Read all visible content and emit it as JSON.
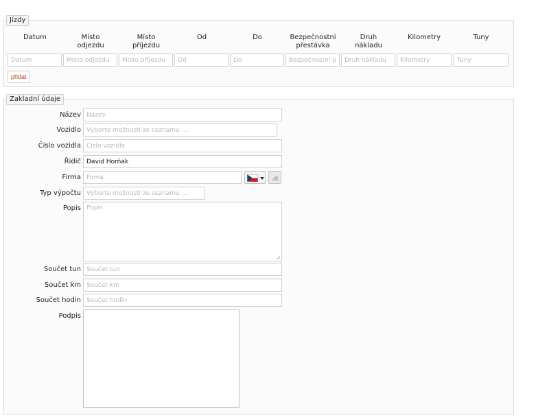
{
  "trips": {
    "legend": "Jízdy",
    "columns": [
      {
        "header": "Datum",
        "placeholder": "Datum"
      },
      {
        "header": "Místo\nodjezdu",
        "placeholder": "Místo odjezdu"
      },
      {
        "header": "Místo\npříjezdu",
        "placeholder": "Místo příjezdu"
      },
      {
        "header": "Od",
        "placeholder": "Od"
      },
      {
        "header": "Do",
        "placeholder": "Do"
      },
      {
        "header": "Bezpečnostní\npřestávka",
        "placeholder": "Bezpečnostní při"
      },
      {
        "header": "Druh\nnákladu",
        "placeholder": "Druh nákladu"
      },
      {
        "header": "Kilometry",
        "placeholder": "Kilometry"
      },
      {
        "header": "Tuny",
        "placeholder": "Tuny"
      }
    ],
    "add_label": "přidat"
  },
  "basic": {
    "legend": "Zakladní údaje",
    "name": {
      "label": "Název",
      "placeholder": "Název"
    },
    "vehicle": {
      "label": "Vozidlo",
      "placeholder": "Vyberte možnosti ze seznamu ..."
    },
    "vehicle_number": {
      "label": "Číslo vozidla",
      "placeholder": "Číslo vozidla"
    },
    "driver": {
      "label": "Řidič",
      "value": "David Horňák"
    },
    "company": {
      "label": "Firma",
      "placeholder": "Firma"
    },
    "calc_type": {
      "label": "Typ výpočtu",
      "placeholder": "Vyberte možnosti ze seznamu ..."
    },
    "description": {
      "label": "Popis",
      "placeholder": "Popis"
    },
    "sum_tons": {
      "label": "Součet tun",
      "placeholder": "Součet tun"
    },
    "sum_km": {
      "label": "Součet km",
      "placeholder": "Součet km"
    },
    "sum_hours": {
      "label": "Součet hodin",
      "placeholder": "Součet hodin"
    },
    "signature": {
      "label": "Podpis"
    }
  },
  "icons": {
    "flag": "czech-flag-icon",
    "dropdown": "caret-down-icon",
    "eraser": "eraser-icon"
  },
  "colors": {
    "add_text": "#c0392b",
    "flag_blue": "#11457e",
    "flag_red": "#d7141a"
  }
}
